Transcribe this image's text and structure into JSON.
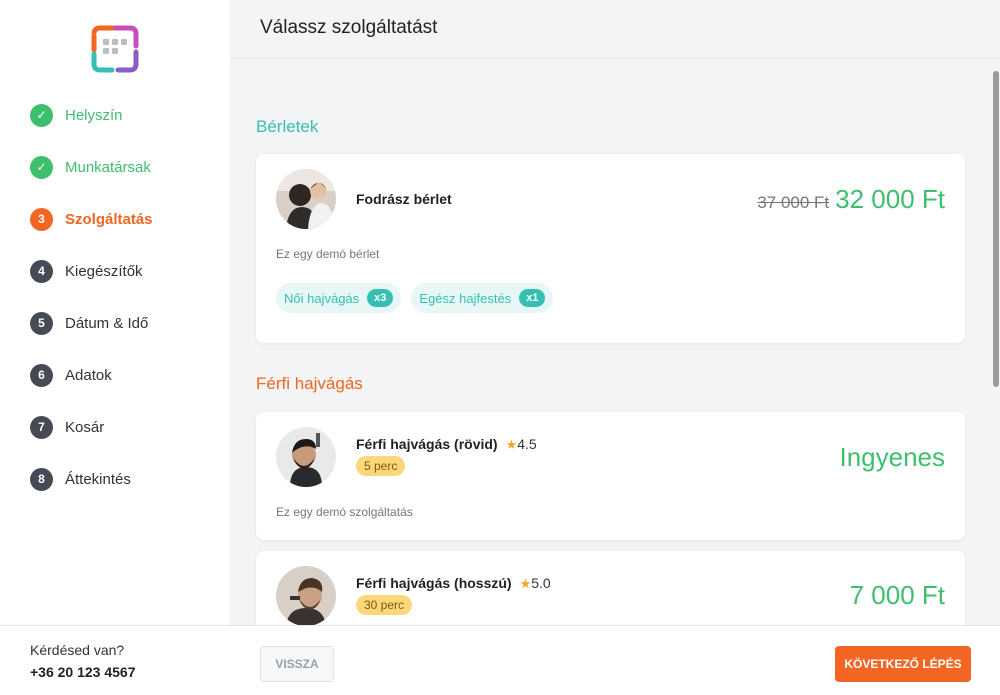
{
  "sidebar": {
    "logo": "app-logo",
    "steps": [
      {
        "num": "✓",
        "label": "Helyszín",
        "state": "done"
      },
      {
        "num": "✓",
        "label": "Munkatársak",
        "state": "done"
      },
      {
        "num": "3",
        "label": "Szolgáltatás",
        "state": "active"
      },
      {
        "num": "4",
        "label": "Kiegészítők",
        "state": "todo"
      },
      {
        "num": "5",
        "label": "Dátum & Idő",
        "state": "todo"
      },
      {
        "num": "6",
        "label": "Adatok",
        "state": "todo"
      },
      {
        "num": "7",
        "label": "Kosár",
        "state": "todo"
      },
      {
        "num": "8",
        "label": "Áttekintés",
        "state": "todo"
      }
    ]
  },
  "header": {
    "title": "Válassz szolgáltatást"
  },
  "sections": [
    {
      "title": "Bérletek",
      "cards": [
        {
          "name": "Fodrász bérlet",
          "old_price": "37 000 Ft",
          "price": "32 000 Ft",
          "description": "Ez egy demó bérlet",
          "tags": [
            {
              "label": "Női hajvágás",
              "count": "x3"
            },
            {
              "label": "Egész hajfestés",
              "count": "x1"
            }
          ]
        }
      ]
    },
    {
      "title": "Férfi hajvágás",
      "cards": [
        {
          "name": "Férfi hajvágás (rövid)",
          "rating": "4.5",
          "duration": "5 perc",
          "price": "Ingyenes",
          "description": "Ez egy demó szolgáltatás"
        },
        {
          "name": "Férfi hajvágás (hosszú)",
          "rating": "5.0",
          "duration": "30 perc",
          "price": "7 000 Ft"
        }
      ]
    }
  ],
  "footer": {
    "question": "Kérdésed van?",
    "phone": "+36 20 123 4567",
    "back_label": "VISSZA",
    "next_label": "KÖVETKEZŐ LÉPÉS"
  },
  "colors": {
    "accent_orange": "#f26522",
    "accent_teal": "#35c0b3",
    "success_green": "#3dbf6e",
    "step_dark": "#454a55"
  }
}
